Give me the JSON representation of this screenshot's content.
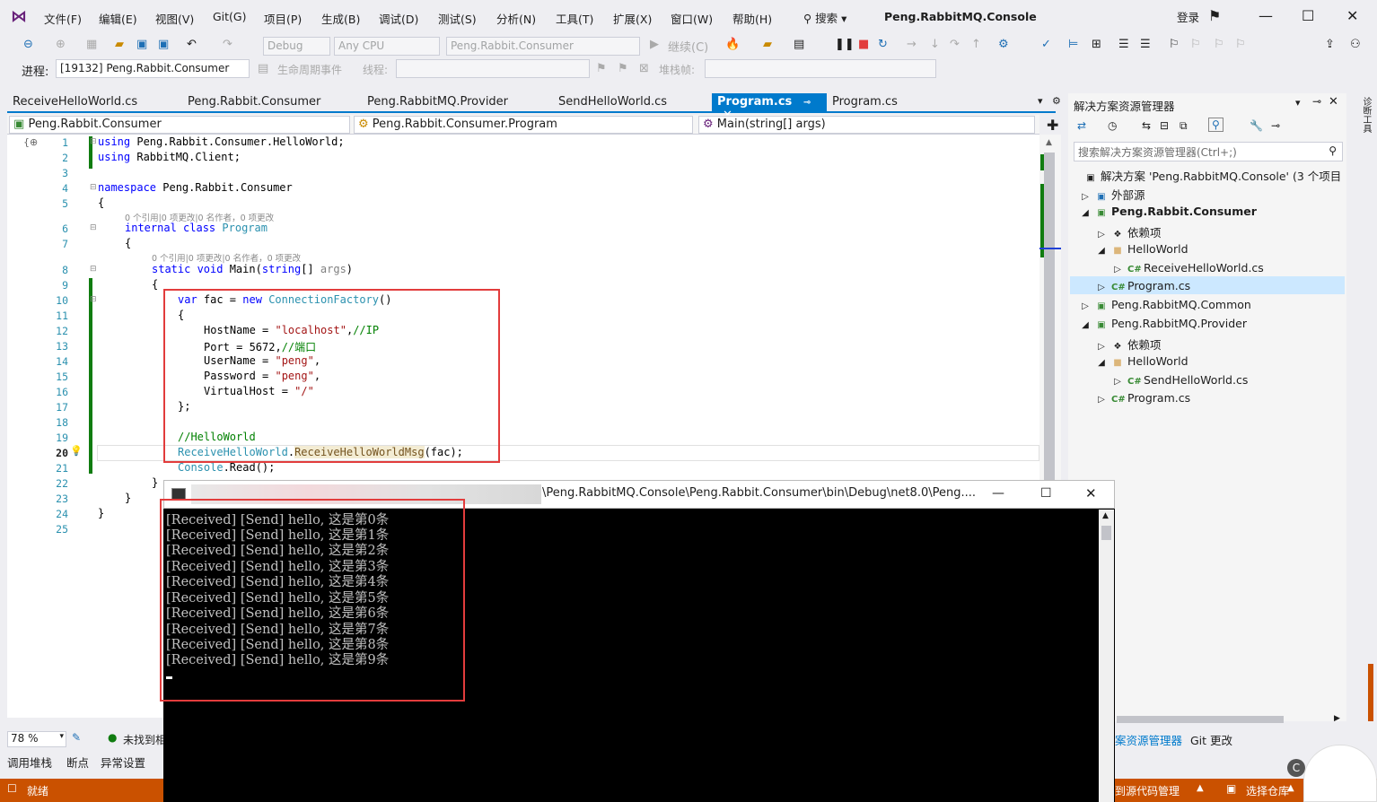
{
  "menubar": {
    "items": [
      "文件(F)",
      "编辑(E)",
      "视图(V)",
      "Git(G)",
      "项目(P)",
      "生成(B)",
      "调试(D)",
      "测试(S)",
      "分析(N)",
      "工具(T)",
      "扩展(X)",
      "窗口(W)",
      "帮助(H)"
    ],
    "search": "搜索",
    "solution_name": "Peng.RabbitMQ.Console",
    "login": "登录"
  },
  "toolbar": {
    "config": "Debug",
    "platform": "Any CPU",
    "startup": "Peng.Rabbit.Consumer",
    "continue": "继续(C)",
    "process_label": "进程:",
    "process": "[19132] Peng.Rabbit.Consumer",
    "lifecycle": "生命周期事件",
    "thread_label": "线程:",
    "stack_label": "堆栈帧:"
  },
  "tabs": [
    {
      "label": "ReceiveHelloWorld.cs",
      "active": false
    },
    {
      "label": "Peng.Rabbit.Consumer",
      "active": false
    },
    {
      "label": "Peng.RabbitMQ.Provider",
      "active": false
    },
    {
      "label": "SendHelloWorld.cs",
      "active": false
    },
    {
      "label": "Program.cs",
      "active": true
    },
    {
      "label": "Program.cs",
      "active": false
    }
  ],
  "navbar": {
    "project": "Peng.Rabbit.Consumer",
    "class": "Peng.Rabbit.Consumer.Program",
    "member": "Main(string[] args)"
  },
  "editor": {
    "line_numbers": [
      "1",
      "2",
      "3",
      "4",
      "5",
      "6",
      "7",
      "8",
      "9",
      "10",
      "11",
      "12",
      "13",
      "14",
      "15",
      "16",
      "17",
      "18",
      "19",
      "20",
      "21",
      "22",
      "23",
      "24",
      "25"
    ],
    "hint1": "0 个引用|0 项更改|0 名作者，0 项更改",
    "hint2": "0 个引用|0 项更改|0 名作者，0 项更改",
    "lines": {
      "l1a": "using",
      "l1b": " Peng.Rabbit.Consumer.HelloWorld;",
      "l2a": "using",
      "l2b": " RabbitMQ.Client;",
      "l4a": "namespace",
      "l4b": " Peng.Rabbit.Consumer",
      "l5": "{",
      "l6a": "internal class",
      "l6b": "Program",
      "l7": "{",
      "l8a": "static void",
      "l8b": " Main(",
      "l8c": "string",
      "l8d": "[] ",
      "l8e": "args",
      "l8f": ")",
      "l9": "{",
      "l10a": "var",
      "l10b": " fac = ",
      "l10c": "new",
      "l10d": "ConnectionFactory",
      "l10e": "()",
      "l11": "{",
      "l12a": "HostName = ",
      "l12b": "\"localhost\"",
      "l12c": ",",
      "l12d": "//IP",
      "l13a": "Port = 5672,",
      "l13b": "//端口",
      "l14a": "UserName = ",
      "l14b": "\"peng\"",
      "l14c": ",",
      "l15a": "Password = ",
      "l15b": "\"peng\"",
      "l15c": ",",
      "l16a": "VirtualHost = ",
      "l16b": "\"/\"",
      "l17": "};",
      "l19": "//HelloWorld",
      "l20a": "ReceiveHelloWorld",
      "l20b": ".",
      "l20c": "ReceiveHelloWorldMsg",
      "l20d": "(fac);",
      "l21a": "Console",
      "l21b": ".Read();",
      "l22": "}",
      "l23": "}",
      "l24": "}"
    }
  },
  "solution_explorer": {
    "title": "解决方案资源管理器",
    "search_placeholder": "搜索解决方案资源管理器(Ctrl+;)",
    "items": [
      {
        "label": "解决方案 'Peng.RabbitMQ.Console' (3 个项目",
        "bold": false
      },
      {
        "label": "外部源",
        "bold": false
      },
      {
        "label": "Peng.Rabbit.Consumer",
        "bold": true
      },
      {
        "label": "依赖项",
        "bold": false
      },
      {
        "label": "HelloWorld",
        "bold": false
      },
      {
        "label": "ReceiveHelloWorld.cs",
        "bold": false
      },
      {
        "label": "Program.cs",
        "bold": false
      },
      {
        "label": "Peng.RabbitMQ.Common",
        "bold": false
      },
      {
        "label": "Peng.RabbitMQ.Provider",
        "bold": false
      },
      {
        "label": "依赖项",
        "bold": false
      },
      {
        "label": "HelloWorld",
        "bold": false
      },
      {
        "label": "SendHelloWorld.cs",
        "bold": false
      },
      {
        "label": "Program.cs",
        "bold": false
      }
    ],
    "bottom_tabs": [
      "案资源管理器",
      "Git 更改"
    ]
  },
  "console": {
    "path": "\\Peng.RabbitMQ.Console\\Peng.Rabbit.Consumer\\bin\\Debug\\net8.0\\Peng....",
    "lines": [
      "[Received] [Send] hello, 这是第0条",
      "[Received] [Send] hello, 这是第1条",
      "[Received] [Send] hello, 这是第2条",
      "[Received] [Send] hello, 这是第3条",
      "[Received] [Send] hello, 这是第4条",
      "[Received] [Send] hello, 这是第5条",
      "[Received] [Send] hello, 这是第6条",
      "[Received] [Send] hello, 这是第7条",
      "[Received] [Send] hello, 这是第8条",
      "[Received] [Send] hello, 这是第9条"
    ]
  },
  "bottom": {
    "zoom": "78 %",
    "issues": "未找到相",
    "tabs": [
      "调用堆栈",
      "断点",
      "异常设置"
    ]
  },
  "statusbar": {
    "ready": "就绪",
    "source_control": "到源代码管理",
    "repo": "选择仓库"
  },
  "colors": {
    "accent": "#007acc",
    "status": "#ca5100",
    "highlight": "#e23c3c"
  }
}
